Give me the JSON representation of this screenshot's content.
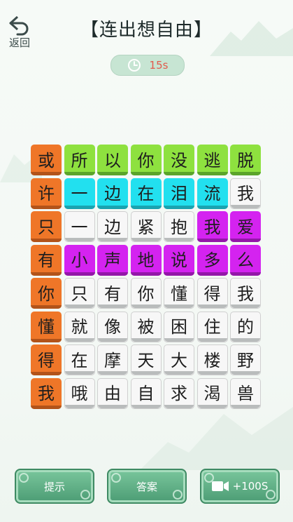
{
  "header": {
    "back_label": "返回",
    "title": "【连出想自由】"
  },
  "timer": {
    "value": "15s",
    "icon": "clock-icon"
  },
  "grid": {
    "rows": [
      [
        {
          "ch": "或",
          "c": "o"
        },
        {
          "ch": "所",
          "c": "g"
        },
        {
          "ch": "以",
          "c": "g"
        },
        {
          "ch": "你",
          "c": "g"
        },
        {
          "ch": "没",
          "c": "g"
        },
        {
          "ch": "逃",
          "c": "g"
        },
        {
          "ch": "脱",
          "c": "g"
        }
      ],
      [
        {
          "ch": "许",
          "c": "o"
        },
        {
          "ch": "一",
          "c": "c"
        },
        {
          "ch": "边",
          "c": "c"
        },
        {
          "ch": "在",
          "c": "c"
        },
        {
          "ch": "泪",
          "c": "c"
        },
        {
          "ch": "流",
          "c": "c"
        },
        {
          "ch": "我",
          "c": "w"
        }
      ],
      [
        {
          "ch": "只",
          "c": "o"
        },
        {
          "ch": "一",
          "c": "w"
        },
        {
          "ch": "边",
          "c": "w"
        },
        {
          "ch": "紧",
          "c": "w"
        },
        {
          "ch": "抱",
          "c": "w"
        },
        {
          "ch": "我",
          "c": "p"
        },
        {
          "ch": "爱",
          "c": "p"
        }
      ],
      [
        {
          "ch": "有",
          "c": "o"
        },
        {
          "ch": "小",
          "c": "p"
        },
        {
          "ch": "声",
          "c": "p"
        },
        {
          "ch": "地",
          "c": "p"
        },
        {
          "ch": "说",
          "c": "p"
        },
        {
          "ch": "多",
          "c": "p"
        },
        {
          "ch": "么",
          "c": "p"
        }
      ],
      [
        {
          "ch": "你",
          "c": "o"
        },
        {
          "ch": "只",
          "c": "w"
        },
        {
          "ch": "有",
          "c": "w"
        },
        {
          "ch": "你",
          "c": "w"
        },
        {
          "ch": "懂",
          "c": "w"
        },
        {
          "ch": "得",
          "c": "w"
        },
        {
          "ch": "我",
          "c": "w"
        }
      ],
      [
        {
          "ch": "懂",
          "c": "o"
        },
        {
          "ch": "就",
          "c": "w"
        },
        {
          "ch": "像",
          "c": "w"
        },
        {
          "ch": "被",
          "c": "w"
        },
        {
          "ch": "困",
          "c": "w"
        },
        {
          "ch": "住",
          "c": "w"
        },
        {
          "ch": "的",
          "c": "w"
        }
      ],
      [
        {
          "ch": "得",
          "c": "o"
        },
        {
          "ch": "在",
          "c": "w"
        },
        {
          "ch": "摩",
          "c": "w"
        },
        {
          "ch": "天",
          "c": "w"
        },
        {
          "ch": "大",
          "c": "w"
        },
        {
          "ch": "楼",
          "c": "w"
        },
        {
          "ch": "野",
          "c": "w"
        }
      ],
      [
        {
          "ch": "我",
          "c": "o"
        },
        {
          "ch": "哦",
          "c": "w"
        },
        {
          "ch": "由",
          "c": "w"
        },
        {
          "ch": "自",
          "c": "w"
        },
        {
          "ch": "求",
          "c": "w"
        },
        {
          "ch": "渴",
          "c": "w"
        },
        {
          "ch": "兽",
          "c": "w"
        }
      ]
    ]
  },
  "buttons": {
    "hint_label": "提示",
    "answer_label": "答案",
    "video_label": "+100S"
  },
  "colors": {
    "orange": "#ef7628",
    "green": "#8ee13f",
    "cyan": "#22e0ef",
    "purple": "#d423f0",
    "white": "#f7f7f7",
    "timer_text": "#e25a4d"
  }
}
